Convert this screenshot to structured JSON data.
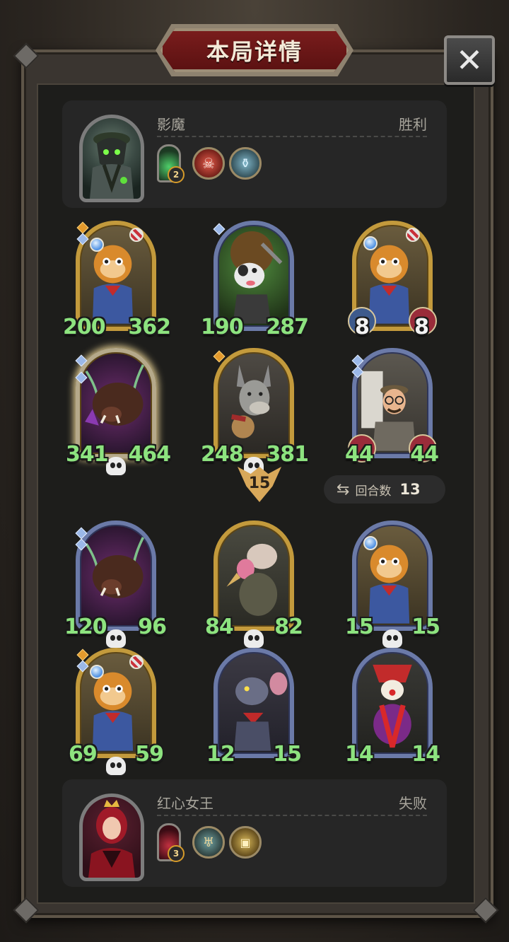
{
  "title": "本局详情",
  "close_icon": "close-icon",
  "round": {
    "label": "回合数",
    "value": "13"
  },
  "turn_marker": "15",
  "players": {
    "top": {
      "name": "影魔",
      "result": "胜利",
      "relic_count": "2",
      "icons": [
        "ghost-relic-icon",
        "skull-mask-icon",
        "potion-jar-icon"
      ]
    },
    "bottom": {
      "name": "红心女王",
      "result": "失败",
      "relic_count": "3",
      "icons": [
        "queen-relic-icon",
        "horn-icon",
        "treasure-chest-icon"
      ]
    }
  },
  "top_board": [
    {
      "name": "raccoon-minion",
      "atk": "200",
      "hp": "362",
      "frame": "gold"
    },
    {
      "name": "dog-miner-minion",
      "atk": "190",
      "hp": "287",
      "frame": "blue"
    },
    {
      "name": "raccoon-minion",
      "atk": "8",
      "hp": "8",
      "frame": "gold"
    },
    {
      "name": "boar-minion",
      "atk": "341",
      "hp": "464",
      "frame": "gold",
      "dead": true
    },
    {
      "name": "donkey-bard-minion",
      "atk": "248",
      "hp": "381",
      "frame": "gold",
      "dead": true
    },
    {
      "name": "scholar-minion",
      "atk": "44",
      "hp": "44",
      "frame": "blue"
    }
  ],
  "bottom_board": [
    {
      "name": "boar-minion",
      "atk": "120",
      "hp": "96",
      "frame": "blue",
      "dead": true
    },
    {
      "name": "vulture-minion",
      "atk": "84",
      "hp": "82",
      "frame": "gold",
      "dead": true
    },
    {
      "name": "raccoon-minion",
      "atk": "15",
      "hp": "15",
      "frame": "blue",
      "dead": true
    },
    {
      "name": "raccoon-minion",
      "atk": "69",
      "hp": "59",
      "frame": "gold",
      "dead": true
    },
    {
      "name": "rat-minion",
      "atk": "12",
      "hp": "15",
      "frame": "blue"
    },
    {
      "name": "clown-minion",
      "atk": "14",
      "hp": "14",
      "frame": "blue"
    }
  ],
  "colors": {
    "stat_green": "#8de37f",
    "gold_frame": "#c39a3c",
    "blue_frame": "#6b7aa8",
    "banner_red": "#7b1d1d"
  }
}
